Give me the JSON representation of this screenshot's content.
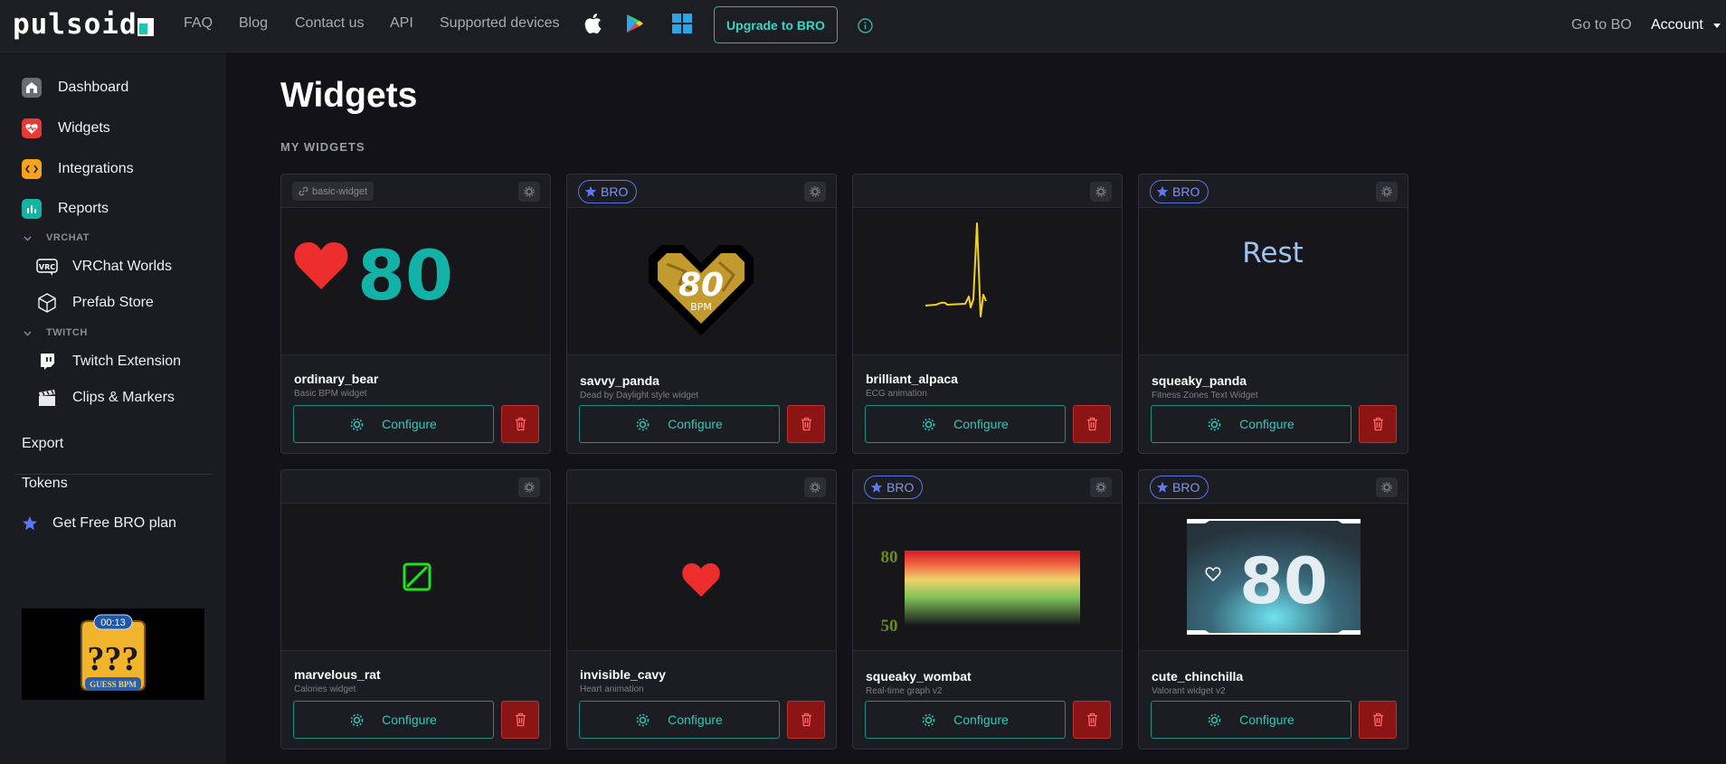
{
  "topbar": {
    "logo": "pulsoid",
    "nav": [
      "FAQ",
      "Blog",
      "Contact us",
      "API",
      "Supported devices"
    ],
    "upgrade": "Upgrade to BRO",
    "goto_bo": "Go to BO",
    "account": "Account"
  },
  "sidebar": {
    "items": [
      "Dashboard",
      "Widgets",
      "Integrations",
      "Reports"
    ],
    "sections": {
      "vrchat": {
        "title": "VRCHAT",
        "items": [
          "VRChat Worlds",
          "Prefab Store"
        ]
      },
      "twitch": {
        "title": "TWITCH",
        "items": [
          "Twitch Extension",
          "Clips & Markers"
        ]
      }
    },
    "export": "Export",
    "tokens": "Tokens",
    "free_bro": "Get Free BRO plan",
    "promo": {
      "timer": "00:13",
      "question": "???",
      "caption": "GUESS BPM"
    }
  },
  "page": {
    "title": "Widgets",
    "section": "MY WIDGETS"
  },
  "labels": {
    "configure": "Configure",
    "bro": "BRO",
    "basic": "basic-widget"
  },
  "widgets": [
    {
      "name": "ordinary_bear",
      "desc": "Basic BPM widget",
      "preview_value": "80"
    },
    {
      "name": "savvy_panda",
      "desc": "Dead by Daylight style widget",
      "preview_value": "80",
      "preview_unit": "BPM"
    },
    {
      "name": "brilliant_alpaca",
      "desc": "ECG animation"
    },
    {
      "name": "squeaky_panda",
      "desc": "Fitness Zones Text Widget",
      "preview_text": "Rest"
    },
    {
      "name": "marvelous_rat",
      "desc": "Calories widget"
    },
    {
      "name": "invisible_cavy",
      "desc": "Heart animation"
    },
    {
      "name": "squeaky_wombat",
      "desc": "Real-time graph v2",
      "axis_top": "80",
      "axis_bottom": "50"
    },
    {
      "name": "cute_chinchilla",
      "desc": "Valorant widget v2",
      "preview_value": "80"
    }
  ],
  "colors": {
    "accent": "#30c9b9",
    "bro": "#7d95f5",
    "danger": "#8b1414",
    "heart": "#ee2d2d"
  }
}
